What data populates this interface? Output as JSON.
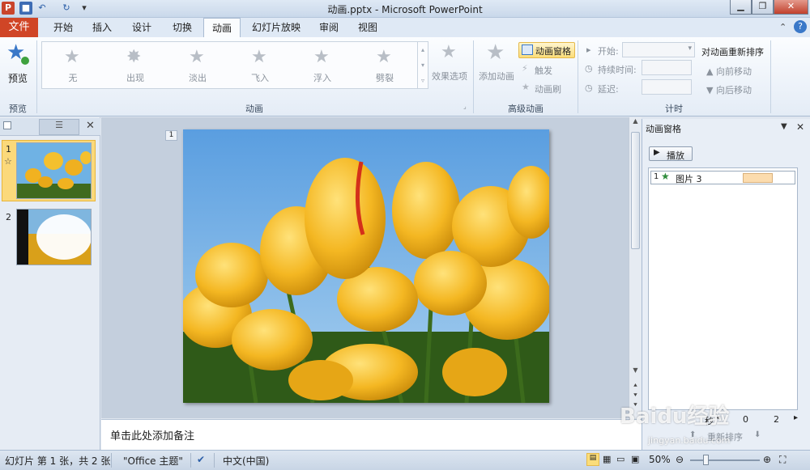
{
  "window": {
    "title": "动画.pptx - Microsoft PowerPoint",
    "app_letter": "P",
    "qat_more": "▾"
  },
  "tabs": [
    "文件",
    "开始",
    "插入",
    "设计",
    "切换",
    "动画",
    "幻灯片放映",
    "审阅",
    "视图"
  ],
  "ribbon": {
    "preview": {
      "label": "预览",
      "group": "预览"
    },
    "animations_group": "动画",
    "animations": [
      "无",
      "出现",
      "淡出",
      "飞入",
      "浮入",
      "劈裂"
    ],
    "effect_options": "效果选项",
    "advanced": {
      "add_animation": "添加动画",
      "animation_pane": "动画窗格",
      "trigger": "触发",
      "painter": "动画刷",
      "group": "高级动画"
    },
    "timing": {
      "start": "开始:",
      "duration": "持续时间:",
      "delay": "延迟:",
      "group": "计时"
    },
    "reorder": {
      "title": "对动画重新排序",
      "earlier": "向前移动",
      "later": "向后移动"
    }
  },
  "slides": [
    {
      "number": "1",
      "marker": "☆"
    },
    {
      "number": "2"
    }
  ],
  "slide_tag": "1",
  "notes_placeholder": "单击此处添加备注",
  "anim_pane": {
    "title": "动画窗格",
    "play_button": "播放",
    "items": [
      {
        "index": "1",
        "name": "图片 3"
      }
    ],
    "footer": {
      "seconds": "秒",
      "zero": "0",
      "two": "2",
      "reorder": "重新排序"
    }
  },
  "watermark": {
    "text": "Baidu经验",
    "url": "jingyan.baidu.com"
  },
  "status": {
    "slide_info": "幻灯片 第 1 张，共 2 张",
    "theme": "\"Office 主题\"",
    "language": "中文(中国)",
    "zoom": "50%"
  },
  "colors": {
    "file_tab": "#d04526",
    "accent": "#f3b531"
  }
}
